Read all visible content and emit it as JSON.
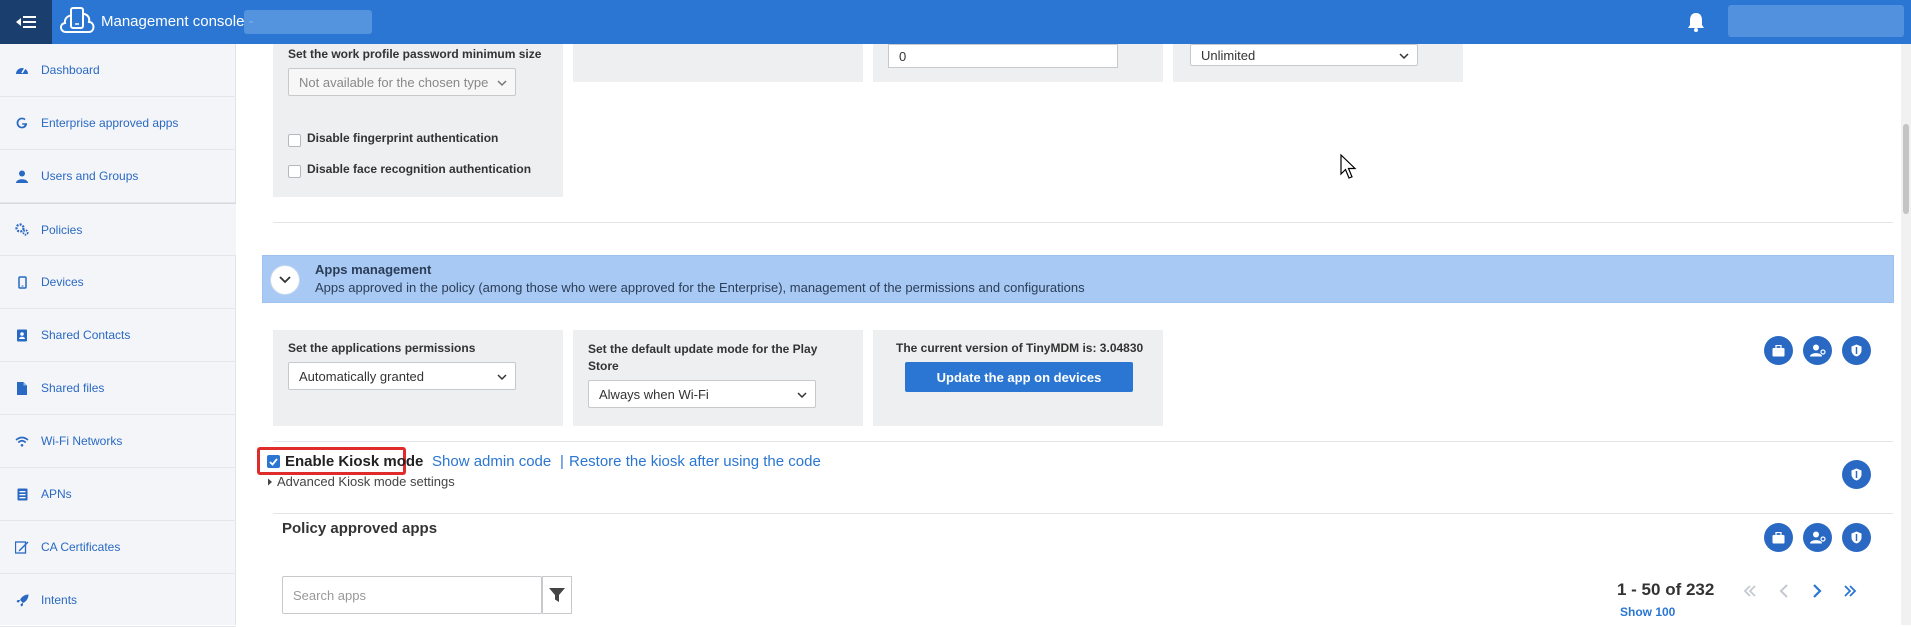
{
  "header": {
    "title": "Management console -"
  },
  "sidebar": {
    "items": [
      {
        "label": "Dashboard",
        "icon": "dashboard-icon"
      },
      {
        "label": "Enterprise approved apps",
        "icon": "google-icon"
      },
      {
        "label": "Users and Groups",
        "icon": "user-icon"
      },
      {
        "label": "Policies",
        "icon": "cogs-icon"
      },
      {
        "label": "Devices",
        "icon": "mobile-icon"
      },
      {
        "label": "Shared Contacts",
        "icon": "contact-book-icon"
      },
      {
        "label": "Shared files",
        "icon": "file-icon"
      },
      {
        "label": "Wi-Fi Networks",
        "icon": "wifi-icon"
      },
      {
        "label": "APNs",
        "icon": "apn-icon"
      },
      {
        "label": "CA Certificates",
        "icon": "certificate-icon"
      },
      {
        "label": "Intents",
        "icon": "rocket-icon"
      }
    ]
  },
  "work_profile": {
    "password_label": "Set the work profile password minimum size",
    "password_value": "Not available for the chosen type",
    "fingerprint_label": "Disable fingerprint authentication",
    "face_label": "Disable face recognition authentication",
    "top_input_value": "0",
    "top_select_value": "Unlimited"
  },
  "apps_management": {
    "title": "Apps management",
    "subtitle": "Apps approved in the policy (among those who were approved for the Enterprise), management of the permissions and configurations",
    "permissions_label": "Set the applications permissions",
    "permissions_value": "Automatically granted",
    "update_mode_label": "Set the default update mode for the Play Store",
    "update_mode_value": "Always when Wi-Fi",
    "version_label": "The current version of TinyMDM is: 3.04830",
    "update_button": "Update the app on devices"
  },
  "kiosk": {
    "label": "Enable Kiosk mode",
    "checked": true,
    "show_admin_code": "Show admin code",
    "separator": "|",
    "restore_link": "Restore the kiosk after using the code",
    "advanced": "Advanced Kiosk mode settings"
  },
  "policy_apps": {
    "title": "Policy approved apps",
    "search_placeholder": "Search apps",
    "pager_count": "1 - 50 of 232",
    "show_more": "Show 100"
  },
  "colors": {
    "header": "#2a76d2",
    "accent": "#2a69c3",
    "section": "#a8c9f3",
    "highlight": "#e02b2b"
  }
}
